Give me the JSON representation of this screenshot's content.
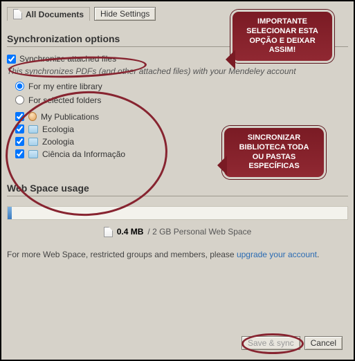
{
  "header": {
    "tab_label": "All Documents",
    "hide_settings_label": "Hide Settings"
  },
  "sync": {
    "heading": "Synchronization options",
    "attached_label": "Synchronize attached files",
    "help_text": "This synchronizes PDFs (and other attached files) with your Mendeley account",
    "radio_entire": "For my entire library",
    "radio_selected": "For selected folders"
  },
  "folders": [
    {
      "label": "My Publications",
      "icon": "person"
    },
    {
      "label": "Ecologia",
      "icon": "folder"
    },
    {
      "label": "Zoologia",
      "icon": "folder"
    },
    {
      "label": "Ciência da Informação",
      "icon": "folder"
    }
  ],
  "webspace": {
    "heading": "Web Space usage",
    "used": "0.4 MB",
    "total": "/ 2 GB Personal Web Space",
    "more_prefix": "For more Web Space, restricted groups and members, please ",
    "more_link": "upgrade your account",
    "more_suffix": "."
  },
  "bottom": {
    "save_sync": "Save & sync",
    "cancel": "Cancel"
  },
  "callouts": {
    "c1_l1": "IMPORTANTE",
    "c1_l2": "SELECIONAR ESTA",
    "c1_l3": "OPÇÃO E DEIXAR",
    "c1_l4": "ASSIM!",
    "c2_l1": "SINCRONIZAR",
    "c2_l2": "BIBLIOTECA TODA",
    "c2_l3": "OU PASTAS",
    "c2_l4": "ESPECÍFICAS"
  }
}
